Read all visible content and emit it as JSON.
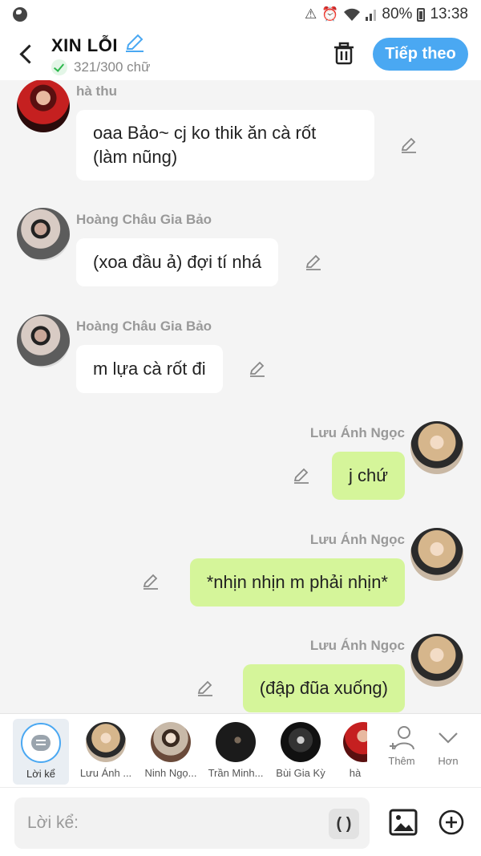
{
  "status_bar": {
    "battery": "80%",
    "time": "13:38"
  },
  "header": {
    "title": "XIN LỖI",
    "count": "321/300 chữ",
    "next_label": "Tiếp theo"
  },
  "messages": [
    {
      "sender": "hà thu",
      "text_lines": [
        "oaa Bảo~ cj ko thik ăn cà rốt",
        "(làm nũng)"
      ],
      "side": "left"
    },
    {
      "sender": "Hoàng Châu Gia Bảo",
      "text": "(xoa đầu ả) đợi tí nhá",
      "side": "left"
    },
    {
      "sender": "Hoàng Châu Gia Bảo",
      "text": "m lựa cà rốt đi",
      "side": "left"
    },
    {
      "sender": "Lưu Ánh Ngọc",
      "text": "j chứ",
      "side": "right"
    },
    {
      "sender": "Lưu Ánh Ngọc",
      "text": "*nhịn nhịn m phải nhịn*",
      "side": "right"
    },
    {
      "sender": "Lưu Ánh Ngọc",
      "text": "(đập đũa xuống)",
      "side": "right"
    }
  ],
  "characters": [
    {
      "name": "Lời kể",
      "active": true
    },
    {
      "name": "Lưu Ánh ..."
    },
    {
      "name": "Ninh Ngọ..."
    },
    {
      "name": "Trần Minh..."
    },
    {
      "name": "Bùi Gia Kỳ"
    },
    {
      "name": "hà"
    }
  ],
  "tools": {
    "add_label": "Thêm",
    "more_label": "Hơn"
  },
  "compose": {
    "placeholder": "Lời kể:",
    "paren": "( )"
  },
  "colors": {
    "accent": "#4aa8f2",
    "right_bubble": "#d5f59a",
    "left_bubble": "#ffffff"
  }
}
